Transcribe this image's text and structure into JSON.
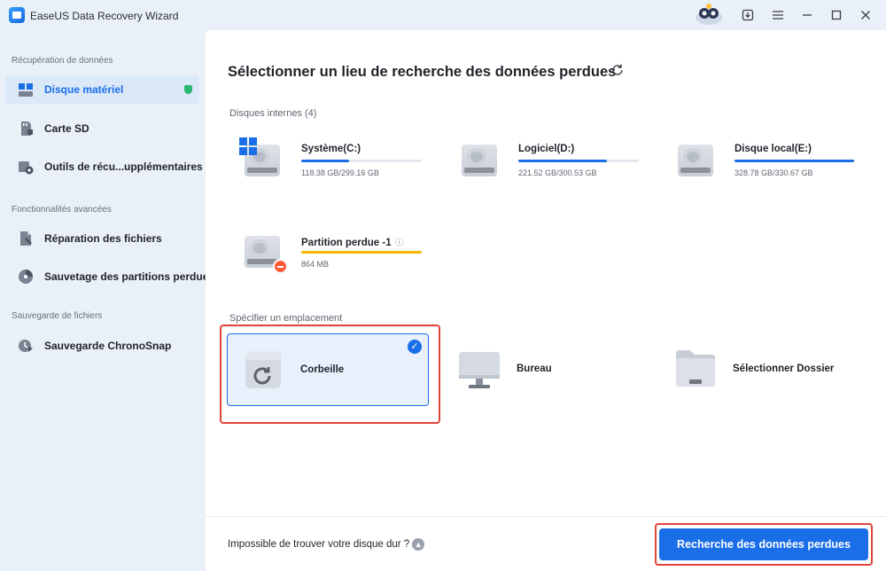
{
  "app": {
    "title": "EaseUS Data Recovery Wizard"
  },
  "titlebar": {
    "icons": [
      "mascot-icon",
      "download-icon",
      "menu-icon",
      "minimize-icon",
      "maximize-icon",
      "close-icon"
    ]
  },
  "sidebar": {
    "sections": [
      {
        "label": "Récupération de données"
      },
      {
        "label": "Fonctionnalités avancées"
      },
      {
        "label": "Sauvegarde de fichiers"
      }
    ],
    "items": [
      {
        "label": "Disque matériel",
        "active": true
      },
      {
        "label": "Carte SD"
      },
      {
        "label": "Outils de récu...upplémentaires"
      },
      {
        "label": "Réparation des fichiers"
      },
      {
        "label": "Sauvetage des partitions perdues"
      },
      {
        "label": "Sauvegarde ChronoSnap"
      }
    ]
  },
  "main": {
    "heading": "Sélectionner un lieu de recherche des données perdues",
    "internal_label": "Disques internes (4)",
    "drives": [
      {
        "name": "Système(C:)",
        "size": "118.38 GB/299.16 GB",
        "used_fraction": 0.396
      },
      {
        "name": "Logiciel(D:)",
        "size": "221.52 GB/300.53 GB",
        "used_fraction": 0.737
      },
      {
        "name": "Disque local(E:)",
        "size": "328.78 GB/330.67 GB",
        "used_fraction": 0.994
      },
      {
        "name": "Partition perdue -1",
        "size": "864 MB",
        "used_fraction": 1.0,
        "bar_color": "#f5b800"
      }
    ],
    "location_label": "Spécifier un emplacement",
    "locations": [
      {
        "name": "Corbeille",
        "selected": true
      },
      {
        "name": "Bureau"
      },
      {
        "name": "Sélectionner Dossier"
      }
    ],
    "cant_find": "Impossible de trouver votre disque dur ?",
    "scan_button": "Recherche des données perdues"
  },
  "colors": {
    "accent": "#1a6ee8",
    "highlight": "#e0443a",
    "lost_bar": "#f5b800"
  }
}
